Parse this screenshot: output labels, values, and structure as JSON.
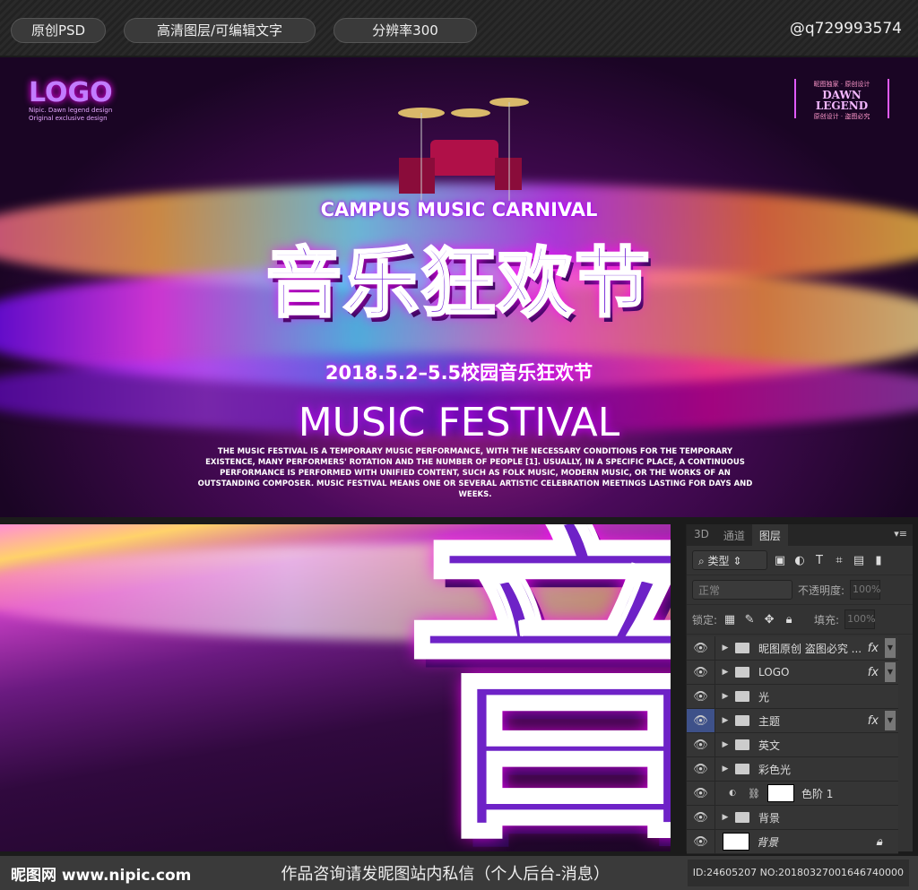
{
  "topbar": {
    "badges": [
      "原创PSD",
      "高清图层/可编辑文字",
      "分辨率300"
    ],
    "contact": "@q729993574"
  },
  "poster": {
    "logo": "LOGO",
    "logo_sub": [
      "Nipic. Dawn legend design",
      "Original exclusive design"
    ],
    "badge": {
      "top": "昵图独家 · 原创设计",
      "title": "DAWN LEGEND",
      "bottom": "原创设计 · 盗图必究"
    },
    "subtitle_en": "CAMPUS MUSIC CARNIVAL",
    "title_cn": "音乐狂欢节",
    "date": "2018.5.2–5.5校园音乐狂欢节",
    "title_en": "MUSIC FESTIVAL",
    "description": "THE MUSIC FESTIVAL IS A TEMPORARY MUSIC PERFORMANCE, WITH THE NECESSARY CONDITIONS FOR THE TEMPORARY EXISTENCE, MANY PERFORMERS' ROTATION AND THE NUMBER OF PEOPLE [1]. USUALLY, IN A SPECIFIC PLACE, A CONTINUOUS PERFORMANCE IS PERFORMED WITH UNIFIED CONTENT, SUCH AS FOLK MUSIC, MODERN MUSIC, OR THE WORKS OF AN OUTSTANDING COMPOSER. MUSIC FESTIVAL MEANS ONE OR SEVERAL ARTISTIC CELEBRATION MEETINGS LASTING FOR DAYS AND WEEKS."
  },
  "detail": {
    "char": "音"
  },
  "panel": {
    "tabs": [
      "3D",
      "通道",
      "图层"
    ],
    "filter": "类型",
    "blend": "正常",
    "opacity_label": "不透明度:",
    "opacity": "100%",
    "lock_label": "锁定:",
    "fill_label": "填充:",
    "fill": "100%",
    "layers": [
      {
        "name": "昵图原创 盗图必究 ...",
        "fx": "fx"
      },
      {
        "name": "LOGO",
        "fx": "fx"
      },
      {
        "name": "光"
      },
      {
        "name": "主题",
        "fx": "fx"
      },
      {
        "name": "英文"
      },
      {
        "name": "彩色光"
      },
      {
        "name": "色阶 1"
      },
      {
        "name": "背景"
      },
      {
        "name": "背景"
      }
    ]
  },
  "footer": {
    "logo": "昵图网 www.nipic.com",
    "note": "作品咨询请发昵图站内私信（个人后台-消息）",
    "id": "ID:24605207 NO:20180327001646740000"
  }
}
